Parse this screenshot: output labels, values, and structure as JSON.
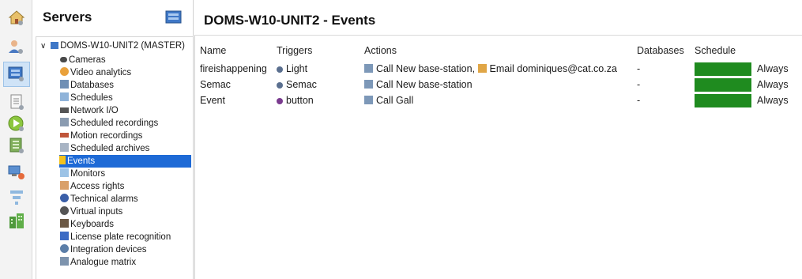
{
  "servers": {
    "title": "Servers",
    "icon": "server-panel-icon",
    "root": {
      "label": "DOMS-W10-UNIT2 (MASTER)",
      "icon": "server-icon",
      "expanded": true,
      "items": [
        {
          "label": "Cameras",
          "icon": "camera-icon"
        },
        {
          "label": "Video analytics",
          "icon": "video-analytics-icon"
        },
        {
          "label": "Databases",
          "icon": "database-icon"
        },
        {
          "label": "Schedules",
          "icon": "schedule-icon"
        },
        {
          "label": "Network I/O",
          "icon": "network-io-icon"
        },
        {
          "label": "Scheduled recordings",
          "icon": "scheduled-recordings-icon"
        },
        {
          "label": "Motion recordings",
          "icon": "motion-recordings-icon"
        },
        {
          "label": "Scheduled archives",
          "icon": "scheduled-archives-icon"
        },
        {
          "label": "Events",
          "icon": "lightning-icon",
          "selected": true
        },
        {
          "label": "Monitors",
          "icon": "monitor-icon"
        },
        {
          "label": "Access rights",
          "icon": "access-rights-icon"
        },
        {
          "label": "Technical alarms",
          "icon": "technical-alarm-icon"
        },
        {
          "label": "Virtual inputs",
          "icon": "virtual-input-icon"
        },
        {
          "label": "Keyboards",
          "icon": "keyboard-icon"
        },
        {
          "label": "License plate recognition",
          "icon": "license-plate-icon"
        },
        {
          "label": "Integration devices",
          "icon": "integration-device-icon"
        },
        {
          "label": "Analogue matrix",
          "icon": "analogue-matrix-icon"
        }
      ]
    }
  },
  "rail": {
    "items": [
      "home-icon",
      "users-icon",
      "servers-icon",
      "documents-icon",
      "play-icon",
      "archive-icon",
      "network-icon",
      "hierarchy-icon",
      "building-icon"
    ],
    "active": "servers-icon"
  },
  "main": {
    "title": "DOMS-W10-UNIT2 - Events",
    "columns": {
      "name": "Name",
      "triggers": "Triggers",
      "actions": "Actions",
      "databases": "Databases",
      "schedule": "Schedule"
    },
    "rows": [
      {
        "name": "fireishappening",
        "trigger": "Light",
        "trigger_icon": "light-trigger-icon",
        "action_1": "Call New base-station,",
        "action_2": "Email dominiques@cat.co.za",
        "databases": "-",
        "schedule": "Always"
      },
      {
        "name": "Semac",
        "trigger": "Semac",
        "trigger_icon": "semac-trigger-icon",
        "action_1": "Call New base-station",
        "action_2": "",
        "databases": "-",
        "schedule": "Always"
      },
      {
        "name": "Event",
        "trigger": "button",
        "trigger_icon": "button-trigger-icon",
        "action_1": "Call Gall",
        "action_2": "",
        "databases": "-",
        "schedule": "Always"
      }
    ]
  },
  "colors": {
    "selection": "#1e6ad6",
    "schedule_bar": "#1f8b1f"
  }
}
